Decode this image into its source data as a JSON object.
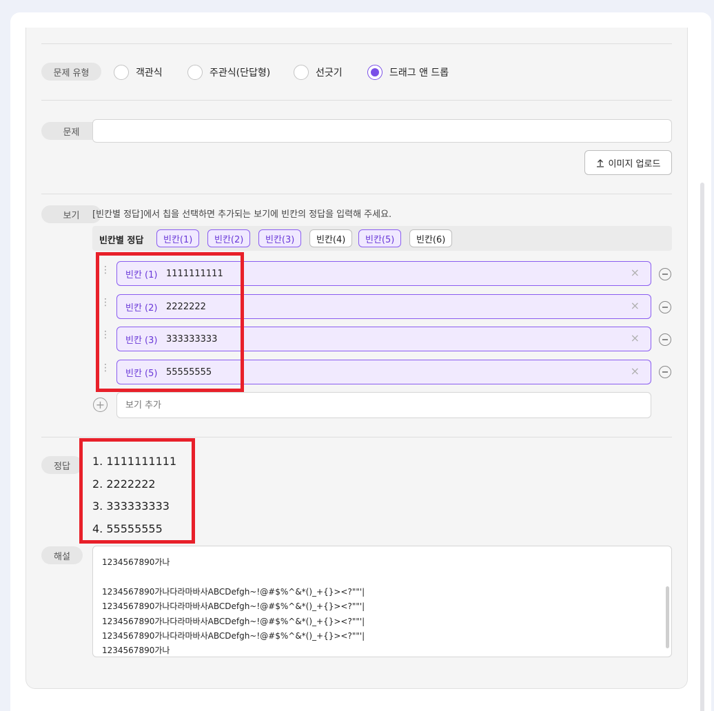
{
  "question_type": {
    "label": "문제 유형",
    "options": [
      {
        "label": "객관식",
        "selected": false
      },
      {
        "label": "주관식(단답형)",
        "selected": false
      },
      {
        "label": "선긋기",
        "selected": false
      },
      {
        "label": "드래그 앤 드롭",
        "selected": true
      }
    ]
  },
  "question": {
    "label": "문제",
    "value": "",
    "upload_label": "이미지 업로드"
  },
  "choices": {
    "label": "보기",
    "guide": "[빈칸별 정답]에서 칩을 선택하면 추가되는 보기에 빈칸의 정답을 입력해 주세요.",
    "chip_bar_label": "빈칸별 정답",
    "chips": [
      {
        "label": "빈칸(1)",
        "selected": true
      },
      {
        "label": "빈칸(2)",
        "selected": true
      },
      {
        "label": "빈칸(3)",
        "selected": true
      },
      {
        "label": "빈칸(4)",
        "selected": false
      },
      {
        "label": "빈칸(5)",
        "selected": true
      },
      {
        "label": "빈칸(6)",
        "selected": false
      }
    ],
    "rows": [
      {
        "tag": "빈칸 (1)",
        "value": "1111111111"
      },
      {
        "tag": "빈칸 (2)",
        "value": "2222222"
      },
      {
        "tag": "빈칸 (3)",
        "value": "333333333"
      },
      {
        "tag": "빈칸 (5)",
        "value": "55555555"
      }
    ],
    "add_placeholder": "보기 추가"
  },
  "answer": {
    "label": "정답",
    "items": [
      "1. 1111111111",
      "2. 2222222",
      "3. 333333333",
      "4. 55555555"
    ]
  },
  "explanation": {
    "label": "해설",
    "lines": [
      "1234567890가나",
      "",
      "1234567890가나다라마바사ABCDefgh~!@#$%^&*()_+{}><?\"\"'|",
      "1234567890가나다라마바사ABCDefgh~!@#$%^&*()_+{}><?\"\"'|",
      "1234567890가나다라마바사ABCDefgh~!@#$%^&*()_+{}><?\"\"'|",
      "1234567890가나다라마바사ABCDefgh~!@#$%^&*()_+{}><?\"\"'|",
      "1234567890가나"
    ]
  },
  "colors": {
    "accent": "#7a4fe8",
    "highlight": "#e8202a"
  }
}
